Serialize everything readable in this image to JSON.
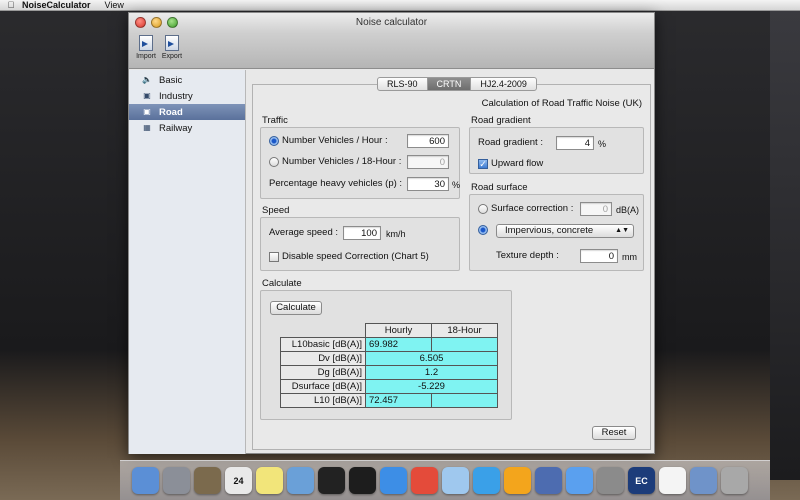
{
  "menubar": {
    "app_name": "NoiseCalculator",
    "menu_view": "View"
  },
  "window": {
    "title": "Noise calculator"
  },
  "toolbar": {
    "import_label": "Import",
    "export_label": "Export"
  },
  "sidebar": {
    "items": [
      {
        "label": "Basic",
        "icon": "speaker-icon"
      },
      {
        "label": "Industry",
        "icon": "factory-icon"
      },
      {
        "label": "Road",
        "icon": "car-icon"
      },
      {
        "label": "Railway",
        "icon": "train-icon"
      }
    ],
    "active_index": 2
  },
  "tabs": {
    "items": [
      "RLS-90",
      "CRTN",
      "HJ2.4-2009"
    ],
    "active": "CRTN"
  },
  "panel": {
    "title": "Calculation of Road Traffic Noise (UK)"
  },
  "traffic": {
    "label": "Traffic",
    "vehicles_hour_label": "Number Vehicles / Hour :",
    "vehicles_hour_value": "600",
    "vehicles_18_label": "Number Vehicles / 18-Hour :",
    "vehicles_18_value": "0",
    "heavy_label": "Percentage heavy vehicles (p) :",
    "heavy_value": "30",
    "heavy_unit": "%"
  },
  "speed": {
    "label": "Speed",
    "avg_label": "Average speed :",
    "avg_value": "100",
    "avg_unit": "km/h",
    "disable_label": "Disable speed Correction (Chart 5)"
  },
  "gradient": {
    "label": "Road gradient",
    "gradient_label": "Road gradient :",
    "gradient_value": "4",
    "gradient_unit": "%",
    "upward_label": "Upward flow"
  },
  "surface": {
    "label": "Road surface",
    "correction_label": "Surface correction :",
    "correction_value": "0",
    "correction_unit": "dB(A)",
    "select_value": "Impervious, concrete",
    "texture_label": "Texture depth :",
    "texture_value": "0",
    "texture_unit": "mm"
  },
  "calculate": {
    "label": "Calculate",
    "button_label": "Calculate",
    "headers": [
      "Hourly",
      "18-Hour"
    ],
    "rows": [
      {
        "label": "L10basic [dB(A)]",
        "hourly": "69.982",
        "h18": ""
      },
      {
        "label": "Dv [dB(A)]",
        "merged": "6.505"
      },
      {
        "label": "Dg [dB(A)]",
        "merged": "1.2"
      },
      {
        "label": "Dsurface [dB(A)]",
        "merged": "-5.229"
      },
      {
        "label": "L10 [dB(A)]",
        "hourly": "72.457",
        "h18": ""
      }
    ]
  },
  "reset_label": "Reset",
  "dock": {
    "icons": [
      "finder-icon",
      "launchpad-icon",
      "system-info-icon",
      "calendar-icon",
      "stickies-icon",
      "photos-icon",
      "terminal-icon",
      "qq-icon",
      "safari-icon",
      "chrome-icon",
      "preview-icon",
      "itunes-icon",
      "kugou-icon",
      "instruments-icon",
      "app-store-icon",
      "system-preferences-icon",
      "ec-icon",
      "document-icon",
      "downloads-icon",
      "trash-icon"
    ],
    "calendar_day": "24",
    "ec_label": "EC",
    "colors": [
      "#5b8fd6",
      "#8b8f98",
      "#7b6a4d",
      "#e9e9e9",
      "#f2e57a",
      "#6aa0d8",
      "#222222",
      "#1d1d1d",
      "#3d8ee6",
      "#e44b3a",
      "#9fc8ee",
      "#3aa0e8",
      "#f3a51c",
      "#4d6cb0",
      "#5aa0ef",
      "#8b8b8b",
      "#1c3c7a",
      "#f4f4f4",
      "#6f93c9",
      "#a8a8a8"
    ]
  }
}
